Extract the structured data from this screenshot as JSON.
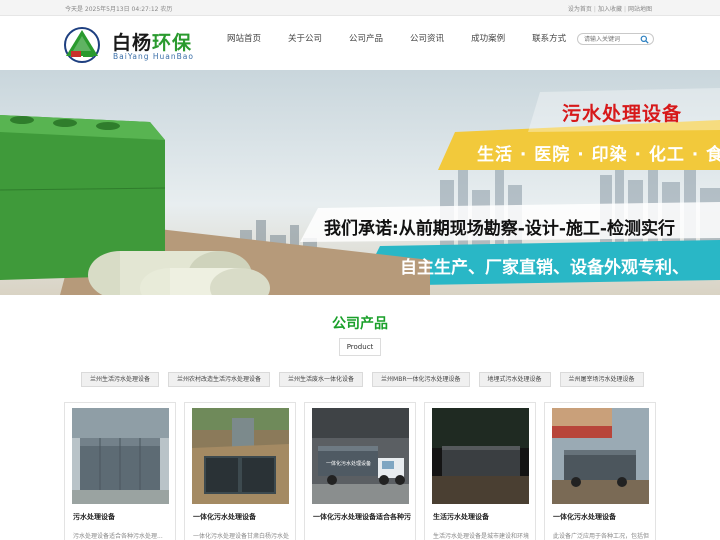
{
  "topbar": {
    "date_text": "今天是 2025年5月13日 04:27:12 农历",
    "links": [
      "设为首页",
      "加入收藏",
      "网站地图"
    ]
  },
  "logo": {
    "title_part1": "白杨",
    "title_part2": "环保",
    "subtitle": "BaiYang HuanBao",
    "mark_text_left": "白杨",
    "mark_text_right": "环保",
    "colors": {
      "green": "#2a9a2e",
      "navy": "#1e3f80",
      "red": "#c8302a"
    }
  },
  "nav": {
    "items": [
      "网站首页",
      "关于公司",
      "公司产品",
      "公司资讯",
      "成功案例",
      "联系方式"
    ]
  },
  "search": {
    "placeholder": "请输入关键词"
  },
  "banner": {
    "title": "污水处理设备",
    "fields": "生活 · 医院 · 印染 · 化工 · 食",
    "promise": "我们承诺:从前期现场勘察-设计-施工-检测实行",
    "self": "自主生产、厂家直销、设备外观专利、"
  },
  "products": {
    "title": "公司产品",
    "subtitle": "Product",
    "categories": [
      "兰州生活污水处理设备",
      "兰州农村改造生活污水处理设备",
      "兰州生活废水一体化设备",
      "兰州MBR一体化污水处理设备",
      "地埋式污水处理设备",
      "兰州屠宰场污水处理设备"
    ],
    "cards": [
      {
        "name": "污水处理设备",
        "desc": "污水处理设备适合各种污水处理..."
      },
      {
        "name": "一体化污水处理设备",
        "desc": "一体化污水处理设备甘肃白杨污水处"
      },
      {
        "name": "一体化污水处理设备适合各种污",
        "desc": ""
      },
      {
        "name": "生活污水处理设备",
        "desc": "生活污水处理设备是城市建设和环境"
      },
      {
        "name": "一体化污水处理设备",
        "desc": "此设备广泛应用于各种工况，包括但"
      }
    ],
    "card_text_on_image": "一体化污水处理设备"
  }
}
